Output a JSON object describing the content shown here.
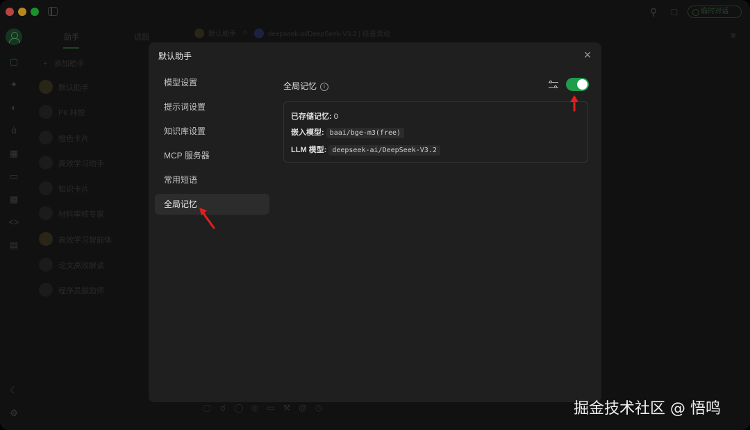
{
  "app": {
    "title_button": "临时对话",
    "nav_tabs": [
      "助手",
      "话题"
    ],
    "add_assistant": "添加助手",
    "assistants": [
      {
        "name": "默认助手",
        "color": "gold"
      },
      {
        "name": "P8 林悦",
        "color": "grey"
      },
      {
        "name": "橙色卡片",
        "color": "grey"
      },
      {
        "name": "高效学习助手",
        "color": "grey"
      },
      {
        "name": "知识卡片",
        "color": "grey"
      },
      {
        "name": "材料审核专家",
        "color": "grey"
      },
      {
        "name": "高效学习智能体",
        "color": "gold"
      },
      {
        "name": "论文高效解读",
        "color": "grey"
      },
      {
        "name": "程序员鼓励师",
        "color": "grey"
      }
    ],
    "chat_header": {
      "assistant": "默认助手",
      "separator": ">",
      "model": "deepseek-ai/DeepSeek-V3.2 | 硅基流动"
    }
  },
  "modal": {
    "title": "默认助手",
    "close_icon": "×",
    "menu": [
      "模型设置",
      "提示词设置",
      "知识库设置",
      "MCP 服务器",
      "常用短语",
      "全局记忆"
    ],
    "active_menu_index": 5,
    "memory": {
      "title": "全局记忆",
      "enabled": true,
      "stored_label": "已存储记忆:",
      "stored_count": "0",
      "embed_label": "嵌入模型:",
      "embed_model": "baai/bge-m3(free)",
      "llm_label": "LLM 模型:",
      "llm_model": "deepseek-ai/DeepSeek-V3.2"
    }
  },
  "colors": {
    "accent": "#1f9d4c",
    "annotation_arrow": "#e02020"
  },
  "watermark": "掘金技术社区 @ 悟鸣"
}
